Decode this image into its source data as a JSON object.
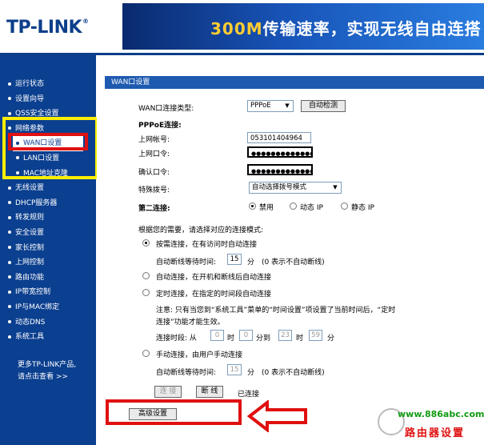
{
  "header": {
    "logo": "TP-LINK",
    "logo_reg": "®",
    "banner_prefix": "300M",
    "banner_text": "传输速率，实现无线自由连搭"
  },
  "sidebar": {
    "items": [
      {
        "label": "运行状态",
        "type": "main"
      },
      {
        "label": "设置向导",
        "type": "main"
      },
      {
        "label": "QSS安全设置",
        "type": "main"
      },
      {
        "label": "网络参数",
        "type": "main"
      },
      {
        "label": "WAN口设置",
        "type": "sub",
        "active": true
      },
      {
        "label": "LAN口设置",
        "type": "sub"
      },
      {
        "label": "MAC地址克隆",
        "type": "sub"
      },
      {
        "label": "无线设置",
        "type": "main"
      },
      {
        "label": "DHCP服务器",
        "type": "main"
      },
      {
        "label": "转发规则",
        "type": "main"
      },
      {
        "label": "安全设置",
        "type": "main"
      },
      {
        "label": "家长控制",
        "type": "main"
      },
      {
        "label": "上网控制",
        "type": "main"
      },
      {
        "label": "路由功能",
        "type": "main"
      },
      {
        "label": "IP带宽控制",
        "type": "main"
      },
      {
        "label": "IP与MAC绑定",
        "type": "main"
      },
      {
        "label": "动态DNS",
        "type": "main"
      },
      {
        "label": "系统工具",
        "type": "main"
      }
    ],
    "footer_line1": "更多TP-LINK产品,",
    "footer_line2": "请点击查看 >>"
  },
  "panel": {
    "title": "WAN口设置",
    "wan_type_label": "WAN口连接类型:",
    "wan_type_value": "PPPoE",
    "auto_detect_button": "自动检测",
    "pppoe_section": "PPPoE连接:",
    "account_label": "上网帐号:",
    "account_value": "053101404964",
    "password_label": "上网口令:",
    "password_value": "●●●●●●●●●●●●●",
    "confirm_label": "确认口令:",
    "confirm_value": "●●●●●●●●●●●●●",
    "dial_label": "特殊拨号:",
    "dial_value": "自动选择拨号模式",
    "second_conn_label": "第二连接:",
    "second_options": [
      "禁用",
      "动态 IP",
      "静态 IP"
    ],
    "mode_intro": "根据您的需要，请选择对应的连接模式:",
    "mode_demand": "按需连接，在有访问时自动连接",
    "auto_disconnect_label": "自动断线等待时间:",
    "auto_disconnect_value": "15",
    "minutes": "分",
    "auto_disconnect_hint": "(0 表示不自动断线)",
    "mode_auto": "自动连接，在开机和断线后自动连接",
    "mode_timed": "定时连接，在指定的时间段自动连接",
    "timed_note_1": "注意: 只有当您到“系统工具”菜单的“时间设置”项设置了当前时间后，“定时",
    "timed_note_2": "连接”功能才能生效。",
    "time_period_label": "连接时段: 从",
    "time_from_h": "0",
    "hour": "时",
    "time_from_m": "0",
    "minute_to": "分到",
    "time_to_h": "23",
    "time_to_m": "59",
    "minute_end": "分",
    "mode_manual": "手动连接，由用户手动连接",
    "manual_wait_label": "自动断线等待时间:",
    "manual_wait_value": "15",
    "connect_button": "连 接",
    "disconnect_button": "断 线",
    "status_text": "已连接",
    "advanced_button": "高级设置"
  },
  "watermark": {
    "url": "www.886abc.com",
    "name": "路由器设置"
  },
  "colors": {
    "sidebar_bg": "#0b3f8f",
    "panel_header": "#1e5ab0",
    "highlight_yellow": "#ffee00",
    "highlight_red": "#e01010"
  }
}
